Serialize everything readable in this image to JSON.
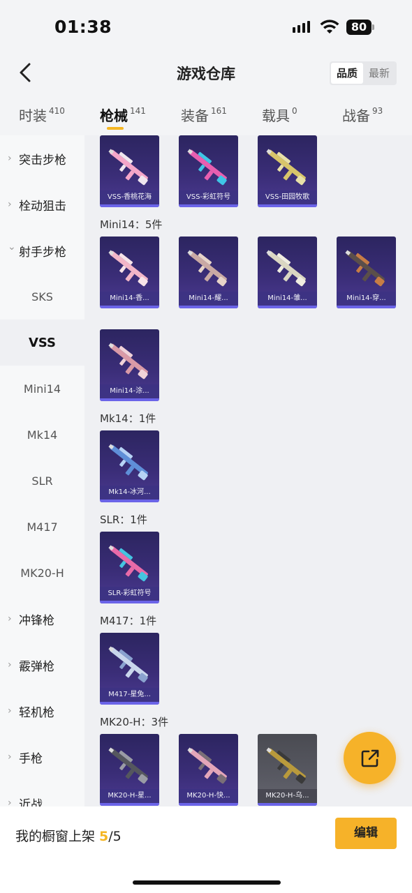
{
  "status_bar": {
    "time": "01:38",
    "battery": "80"
  },
  "header": {
    "title": "游戏仓库",
    "sort_options": [
      "品质",
      "最新"
    ],
    "sort_selected": "品质"
  },
  "tabs": [
    {
      "label": "时装",
      "count": "410"
    },
    {
      "label": "枪械",
      "count": "141",
      "active": true
    },
    {
      "label": "装备",
      "count": "161"
    },
    {
      "label": "载具",
      "count": "0"
    },
    {
      "label": "战备",
      "count": "93"
    }
  ],
  "sidebar": [
    {
      "label": "突击步枪",
      "type": "parent",
      "expanded": false
    },
    {
      "label": "栓动狙击",
      "type": "parent",
      "expanded": false
    },
    {
      "label": "射手步枪",
      "type": "parent",
      "expanded": true
    },
    {
      "label": "SKS",
      "type": "child"
    },
    {
      "label": "VSS",
      "type": "child",
      "selected": true
    },
    {
      "label": "Mini14",
      "type": "child"
    },
    {
      "label": "Mk14",
      "type": "child"
    },
    {
      "label": "SLR",
      "type": "child"
    },
    {
      "label": "M417",
      "type": "child"
    },
    {
      "label": "MK20-H",
      "type": "child"
    },
    {
      "label": "冲锋枪",
      "type": "parent",
      "expanded": false
    },
    {
      "label": "霰弹枪",
      "type": "parent",
      "expanded": false
    },
    {
      "label": "轻机枪",
      "type": "parent",
      "expanded": false
    },
    {
      "label": "手枪",
      "type": "parent",
      "expanded": false
    },
    {
      "label": "近战",
      "type": "parent",
      "expanded": false
    }
  ],
  "sections": [
    {
      "label": "",
      "items": [
        {
          "name": "VSS-香桃花海",
          "color": "#f4a6c9",
          "accent": "#f0e6ef"
        },
        {
          "name": "VSS-彩虹符号",
          "color": "#e85fb0",
          "accent": "#3fc6e6"
        },
        {
          "name": "VSS-田园牧歌",
          "color": "#d8c56a",
          "accent": "#e8e0a8"
        }
      ]
    },
    {
      "label": "Mini14：5件",
      "items": [
        {
          "name": "Mini14-香...",
          "color": "#f2b6c8",
          "accent": "#f7e3e8"
        },
        {
          "name": "Mini14-耀...",
          "color": "#c9a9a4",
          "accent": "#e7d4c8"
        },
        {
          "name": "Mini14-雏...",
          "color": "#dad6c2",
          "accent": "#f0ede0"
        },
        {
          "name": "Mini14-穿...",
          "color": "#5b4f4a",
          "accent": "#c77d45"
        },
        {
          "name": "Mini14-涂...",
          "color": "#d99aa7",
          "accent": "#f0d2d8"
        }
      ]
    },
    {
      "label": "Mk14：1件",
      "items": [
        {
          "name": "Mk14-冰河...",
          "color": "#5f8fd8",
          "accent": "#b7d3f5"
        }
      ]
    },
    {
      "label": "SLR：1件",
      "items": [
        {
          "name": "SLR-彩虹符号",
          "color": "#e86aa8",
          "accent": "#44c4e0"
        }
      ]
    },
    {
      "label": "M417：1件",
      "items": [
        {
          "name": "M417-星兔...",
          "color": "#c9d6ec",
          "accent": "#8aa2cf"
        }
      ]
    },
    {
      "label": "MK20-H：3件",
      "items": [
        {
          "name": "MK20-H-星...",
          "color": "#55575e",
          "accent": "#9a9ca5"
        },
        {
          "name": "MK20-H-快...",
          "color": "#e3a6b9",
          "accent": "#7a6f77"
        },
        {
          "name": "MK20-H-乌...",
          "color": "#b99a3c",
          "accent": "#3a3a3a",
          "gray": true
        }
      ]
    }
  ],
  "footer": {
    "showcase_label": "我的橱窗上架 ",
    "showcase_count": "5",
    "showcase_total": "/5",
    "edit_label": "编辑"
  },
  "colors": {
    "accent": "#f6b229",
    "card_bg": "#3a2d77"
  }
}
